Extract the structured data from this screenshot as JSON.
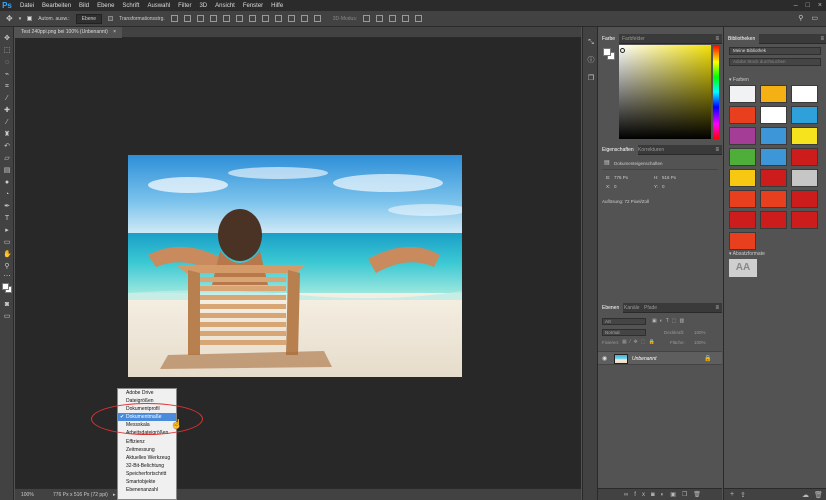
{
  "app": {
    "logo": "Ps"
  },
  "menubar": {
    "items": [
      "Datei",
      "Bearbeiten",
      "Bild",
      "Ebene",
      "Schrift",
      "Auswahl",
      "Filter",
      "3D",
      "Ansicht",
      "Fenster",
      "Hilfe"
    ],
    "window_controls": [
      "–",
      "□",
      "×"
    ]
  },
  "options_bar": {
    "auto_select_label": "Autom. ausw.:",
    "auto_select_value": "Ebene",
    "transform_label": "Transformationsstrg.",
    "mode_3d_label": "3D-Modus:"
  },
  "document": {
    "tab_title": "Test 240ppi.png bei 100% (Unbenannt)",
    "tab_close": "×",
    "zoom": "100%",
    "status": "776 Px x 516 Px (72 ppi)"
  },
  "status_menu": {
    "items": [
      "Adobe Drive",
      "Dateigrößen",
      "Dokumentprofil",
      "Dokumentmaße",
      "Messskala",
      "Arbeitsdateigrößen",
      "Effizienz",
      "Zeitmessung",
      "Aktuelles Werkzeug",
      "32-Bit-Belichtung",
      "Speicherfortschritt",
      "Smartobjekte",
      "Ebenenanzahl"
    ],
    "selected_index": 3,
    "check_mark": "✔"
  },
  "color_panel": {
    "tabs": [
      "Farbe",
      "Farbfelder"
    ],
    "menu_icon": "≡"
  },
  "properties_panel": {
    "tabs": [
      "Eigenschaften",
      "Korrekturen"
    ],
    "subtitle": "Dokumenteigenschaften",
    "w_label": "B:",
    "w_value": "776 Px",
    "h_label": "H:",
    "h_value": "516 Px",
    "x_label": "X:",
    "x_value": "0",
    "y_label": "Y:",
    "y_value": "0",
    "resolution": "Auflösung: 72 Pixel/Zoll"
  },
  "layers_panel": {
    "tabs": [
      "Ebenen",
      "Kanäle",
      "Pfade"
    ],
    "search_placeholder": "Art",
    "blend_mode": "Normal",
    "opacity_label": "Deckkraft:",
    "opacity_value": "100%",
    "fill_label": "Fläche:",
    "fill_value": "100%",
    "lock_label": "Fixieren:",
    "layers": [
      {
        "name": "Unbenannt"
      }
    ]
  },
  "libraries_panel": {
    "title": "Bibliotheken",
    "library_name": "Meine Bibliothek",
    "search_placeholder": "Adobe Stock durchsuchen",
    "colors_label": "Farben",
    "char_styles_label": "Absatzformate",
    "sample_text": "AA",
    "swatches": [
      "#f1f2f4",
      "#f5b114",
      "#ffffff",
      "#e8401f",
      "#ffffff",
      "#2ea0da",
      "#a33d96",
      "#3c96d8",
      "#f7e21e",
      "#4fae3a",
      "#3c96d8",
      "#cc1c1c",
      "#f6c812",
      "#cc1c1c",
      "#c6c6c6",
      "#e8401f",
      "#e8401f",
      "#cc1c1c",
      "#cc1c1c",
      "#cc1c1c",
      "#cc1c1c",
      "#e8401f"
    ]
  }
}
